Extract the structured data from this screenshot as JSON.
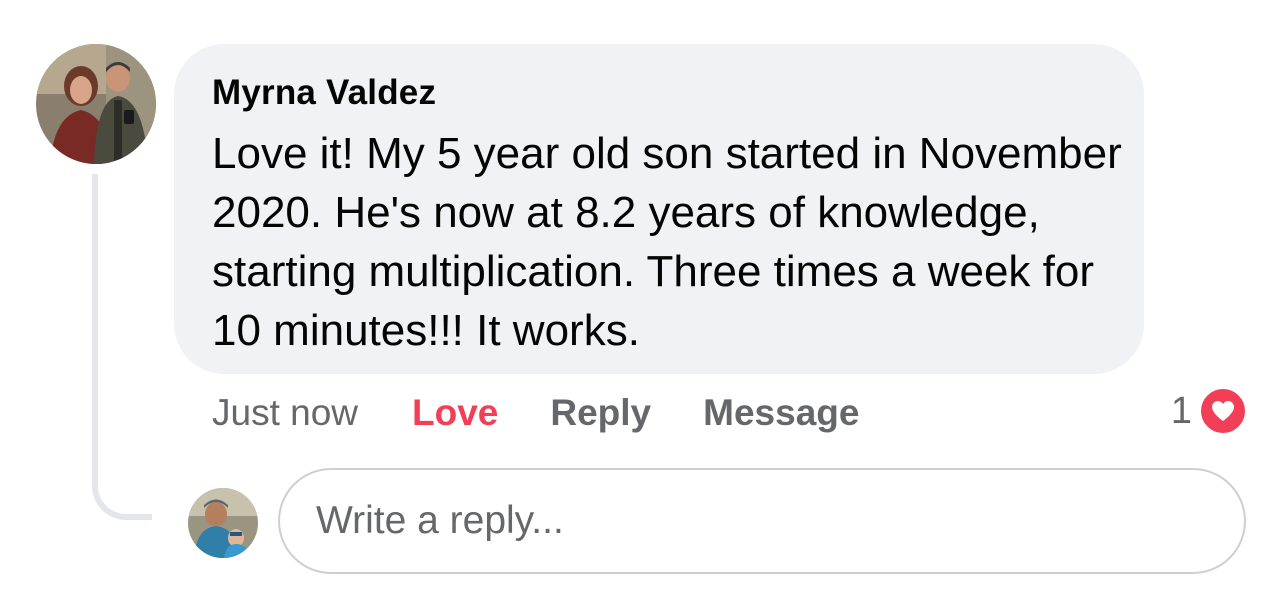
{
  "comment": {
    "author": "Myrna Valdez",
    "text": "Love it! My 5 year old son started in November 2020. He's now at 8.2 years of knowledge, starting multiplication. Three times a week for 10 minutes!!! It works.",
    "timestamp": "Just now",
    "reaction_count": "1",
    "reaction_icon": "heart-icon"
  },
  "actions": {
    "love_label": "Love",
    "reply_label": "Reply",
    "message_label": "Message"
  },
  "reply_input": {
    "placeholder": "Write a reply..."
  },
  "colors": {
    "love_accent": "#f33e58",
    "bubble_bg": "#f0f2f5",
    "secondary_text": "#65676b"
  }
}
